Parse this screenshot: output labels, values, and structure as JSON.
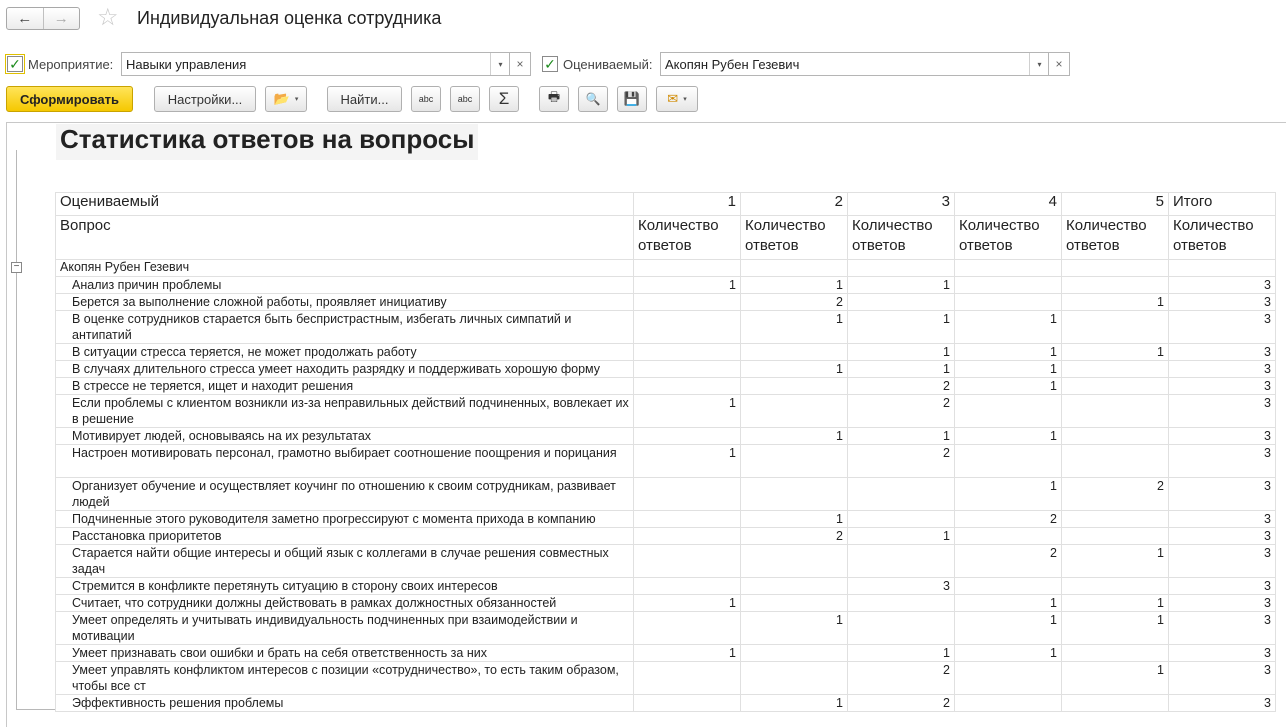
{
  "window": {
    "title": "Индивидуальная оценка сотрудника",
    "back_icon": "←",
    "forward_icon": "→",
    "favorite_icon": "☆"
  },
  "filters": {
    "event": {
      "checked": true,
      "label": "Мероприятие:",
      "value": "Навыки управления"
    },
    "evaluated": {
      "checked": true,
      "label": "Оцениваемый:",
      "value": "Акопян Рубен Гезевич"
    },
    "dropdown_icon": "▾",
    "clear_icon": "×",
    "check_mark": "✓"
  },
  "toolbar": {
    "generate_label": "Сформировать",
    "settings_label": "Настройки...",
    "find_label": "Найти...",
    "sum_icon": "Σ",
    "print_icon": "🖶",
    "preview_icon": "🔍",
    "save_icon": "💾",
    "mail_icon": "✉",
    "variants_icon": "📂",
    "search_abc_icon": "abc",
    "dropdown_icon": "▾"
  },
  "report": {
    "title": "Статистика ответов на вопросы",
    "collapse_icon": "−",
    "header_row1": [
      "Оцениваемый",
      "1",
      "2",
      "3",
      "4",
      "5",
      "Итого"
    ],
    "header_row2": [
      "Вопрос",
      "Количество ответов",
      "Количество ответов",
      "Количество ответов",
      "Количество ответов",
      "Количество ответов",
      "Количество ответов"
    ],
    "group": "Акопян Рубен Гезевич",
    "rows": [
      {
        "q": "Анализ причин проблемы",
        "v": [
          "1",
          "1",
          "1",
          "",
          "",
          "3"
        ]
      },
      {
        "q": "Берется за выполнение сложной работы, проявляет инициативу",
        "v": [
          "",
          "2",
          "",
          "",
          "1",
          "3"
        ]
      },
      {
        "q": "В оценке сотрудников старается быть беспристрастным, избегать  личных симпатий и антипатий",
        "v": [
          "",
          "1",
          "1",
          "1",
          "",
          "3"
        ]
      },
      {
        "q": "В ситуации стресса теряется, не может продолжать работу",
        "v": [
          "",
          "",
          "1",
          "1",
          "1",
          "3"
        ]
      },
      {
        "q": "В случаях длительного стресса умеет находить разрядку и поддерживать хорошую форму",
        "v": [
          "",
          "1",
          "1",
          "1",
          "",
          "3"
        ]
      },
      {
        "q": "В стрессе не теряется, ищет и находит решения",
        "v": [
          "",
          "",
          "2",
          "1",
          "",
          "3"
        ]
      },
      {
        "q": "Если проблемы с клиентом возникли из-за неправильных действий подчиненных, вовлекает их в решение",
        "v": [
          "1",
          "",
          "2",
          "",
          "",
          "3"
        ]
      },
      {
        "q": "Мотивирует людей, основываясь на их результатах",
        "v": [
          "",
          "1",
          "1",
          "1",
          "",
          "3"
        ]
      },
      {
        "q": "Настроен мотивировать персонал, грамотно выбирает соотношение поощрения и порицания",
        "v": [
          "1",
          "",
          "2",
          "",
          "",
          "3"
        ]
      },
      {
        "q": "Организует обучение и осуществляет коучинг по отношению к своим сотрудникам, развивает людей",
        "v": [
          "",
          "",
          "",
          "1",
          "2",
          "3"
        ]
      },
      {
        "q": "Подчиненные этого руководителя заметно прогрессируют с момента прихода в компанию",
        "v": [
          "",
          "1",
          "",
          "2",
          "",
          "3"
        ]
      },
      {
        "q": "Расстановка приоритетов",
        "v": [
          "",
          "2",
          "1",
          "",
          "",
          "3"
        ]
      },
      {
        "q": "Старается найти общие интересы и общий язык с коллегами в случае решения совместных задач",
        "v": [
          "",
          "",
          "",
          "2",
          "1",
          "3"
        ]
      },
      {
        "q": "Стремится в конфликте перетянуть ситуацию в сторону своих интересов",
        "v": [
          "",
          "",
          "3",
          "",
          "",
          "3"
        ]
      },
      {
        "q": "Считает, что сотрудники должны действовать в рамках должностных обязанностей",
        "v": [
          "1",
          "",
          "",
          "1",
          "1",
          "3"
        ]
      },
      {
        "q": "Умеет определять и учитывать индивидуальность подчиненных при взаимодействии и мотивации",
        "v": [
          "",
          "1",
          "",
          "1",
          "1",
          "3"
        ]
      },
      {
        "q": "Умеет признавать свои ошибки и брать на себя ответственность за них",
        "v": [
          "1",
          "",
          "1",
          "1",
          "",
          "3"
        ]
      },
      {
        "q": "Умеет управлять конфликтом интересов с позиции «сотрудничество», то есть таким образом, чтобы все ст",
        "v": [
          "",
          "",
          "2",
          "",
          "1",
          "3"
        ]
      },
      {
        "q": "Эффективность решения проблемы",
        "v": [
          "",
          "1",
          "2",
          "",
          "",
          "3"
        ]
      }
    ]
  }
}
